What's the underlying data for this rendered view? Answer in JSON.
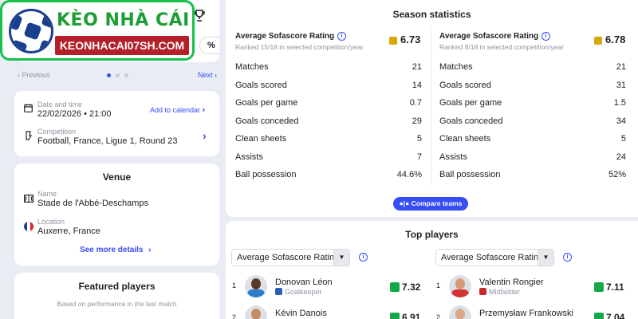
{
  "logo": {
    "title": "KÈO NHÀ CÁI",
    "subtitle": "KEONHACAI07SH.COM"
  },
  "left": {
    "partial_badge": "%",
    "nav": {
      "prev": "Previous",
      "next": "Next"
    },
    "event": {
      "date_label": "Date and time",
      "date_value": "22/02/2026 • 21:00",
      "add_calendar": "Add to calendar",
      "comp_label": "Competition",
      "comp_value": "Football, France, Ligue 1, Round 23"
    },
    "venue": {
      "title": "Venue",
      "name_label": "Name",
      "name_value": "Stade de l'Abbé-Deschamps",
      "loc_label": "Location",
      "loc_value": "Auxerre, France",
      "see_more": "See more details"
    },
    "featured": {
      "title": "Featured players",
      "subtitle": "Based on performance in the last match"
    }
  },
  "season": {
    "title": "Season statistics",
    "teams": [
      {
        "rating_label": "Average Sofascore Rating",
        "rating": "6.73",
        "rank": "Ranked 15/18 in selected competition/year",
        "rating_color": "#d9a600",
        "rows": [
          {
            "label": "Matches",
            "value": "21"
          },
          {
            "label": "Goals scored",
            "value": "14"
          },
          {
            "label": "Goals per game",
            "value": "0.7"
          },
          {
            "label": "Goals conceded",
            "value": "29"
          },
          {
            "label": "Clean sheets",
            "value": "5"
          },
          {
            "label": "Assists",
            "value": "7"
          },
          {
            "label": "Ball possession",
            "value": "44.6%"
          }
        ]
      },
      {
        "rating_label": "Average Sofascore Rating",
        "rating": "6.78",
        "rank": "Ranked 8/18 in selected competition/year",
        "rating_color": "#d9a600",
        "rows": [
          {
            "label": "Matches",
            "value": "21"
          },
          {
            "label": "Goals scored",
            "value": "31"
          },
          {
            "label": "Goals per game",
            "value": "1.5"
          },
          {
            "label": "Goals conceded",
            "value": "34"
          },
          {
            "label": "Clean sheets",
            "value": "5"
          },
          {
            "label": "Assists",
            "value": "24"
          },
          {
            "label": "Ball possession",
            "value": "52%"
          }
        ]
      }
    ],
    "compare_button": "Compare teams"
  },
  "top_players": {
    "title": "Top players",
    "selects": [
      "Average Sofascore Rating",
      "Average Sofascore Rating"
    ],
    "teams": [
      [
        {
          "rank": "1",
          "name": "Donovan Léon",
          "position": "Goalkeeper",
          "score": "7.32"
        },
        {
          "rank": "2",
          "name": "Kévin Danois",
          "position": "",
          "score": "6.91"
        }
      ],
      [
        {
          "rank": "1",
          "name": "Valentin Rongier",
          "position": "Midfielder",
          "score": "7.11"
        },
        {
          "rank": "2",
          "name": "Przemysław Frankowski",
          "position": "",
          "score": "7.04"
        }
      ]
    ],
    "score_color": "#15a84b"
  }
}
